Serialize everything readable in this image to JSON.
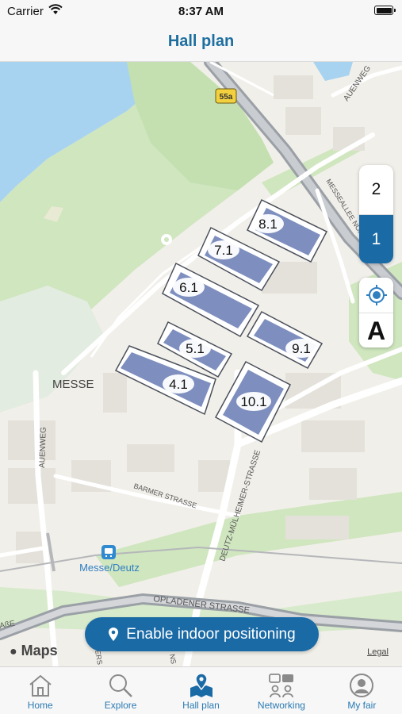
{
  "status": {
    "carrier": "Carrier",
    "time": "8:37 AM"
  },
  "nav": {
    "title": "Hall plan"
  },
  "map": {
    "halls": [
      "8.1",
      "7.1",
      "6.1",
      "5.1",
      "9.1",
      "4.1",
      "10.1"
    ],
    "labels": {
      "messe": "MESSE",
      "auenweg_left": "AUENWEG",
      "auenweg_top": "AUENWEG",
      "messeallee": "MESSEALLEE NORD",
      "barmer": "BARMER STRASSE",
      "deutz": "DEUTZ-MÜLHEIMER-STRASSE",
      "opladener": "OPLADENER STRASSE",
      "station": "Messe/Deutz",
      "route": "55a",
      "edge_left": "AßE",
      "edge_bottom": "ERS",
      "edge_bottom2": "NS"
    },
    "attribution": " Maps",
    "legal": "Legal"
  },
  "floors": {
    "upper": "2",
    "lower": "1",
    "active": "1"
  },
  "icons": {
    "locate": "location-target-icon",
    "a_glyph": "A"
  },
  "cta": {
    "label": "Enable indoor positioning"
  },
  "tabs": [
    {
      "label": "Home",
      "icon": "home-icon"
    },
    {
      "label": "Explore",
      "icon": "search-icon"
    },
    {
      "label": "Hall plan",
      "icon": "map-pin-icon"
    },
    {
      "label": "Networking",
      "icon": "networking-icon"
    },
    {
      "label": "My fair",
      "icon": "profile-icon"
    }
  ],
  "colors": {
    "accent": "#1a6aa6",
    "tab_label": "#2a7ab3",
    "hall_fill": "#7e8fbf",
    "water": "#a8d3f0",
    "park": "#cfe6bf"
  }
}
